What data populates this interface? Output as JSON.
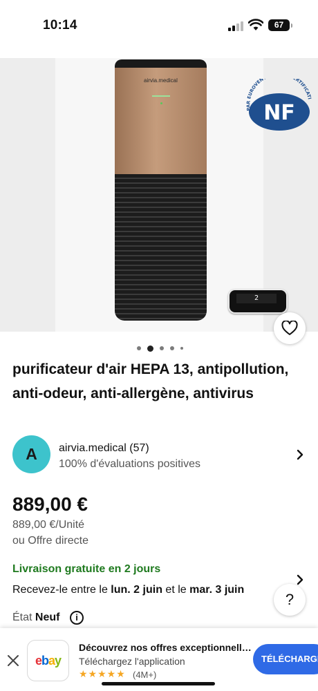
{
  "status_bar": {
    "time": "10:14",
    "battery": "67",
    "icons": [
      "signal-icon",
      "wifi-icon",
      "battery-icon"
    ]
  },
  "product": {
    "image_alt_brand": "airvia.medical",
    "remote_display": "2",
    "carousel_count": 5,
    "carousel_active_index": 1,
    "title": "purificateur d'air HEPA 13, antipollution, anti-odeur, anti-allergène, antivirus"
  },
  "seller": {
    "avatar_letter": "A",
    "name": "airvia.medical (57)",
    "feedback": "100% d'évaluations positives"
  },
  "pricing": {
    "price": "889,00 €",
    "unit_price": "889,00 €/Unité",
    "best_offer": "ou Offre directe"
  },
  "shipping": {
    "free_label": "Livraison gratuite en 2 jours",
    "delivery_prefix": "Recevez-le entre le ",
    "date_start": "lun. 2 juin",
    "delivery_mid": " et le ",
    "date_end": "mar. 3 juin"
  },
  "condition": {
    "label": "État ",
    "value": "Neuf",
    "info_symbol": "i"
  },
  "help": {
    "symbol": "?"
  },
  "app_banner": {
    "close_symbol": "×",
    "logo_letters": [
      "e",
      "b",
      "a",
      "y"
    ],
    "title": "Découvrez nos offres exceptionnelles",
    "subtitle": "Téléchargez l'application",
    "stars": "★★★★★",
    "rating_count": "(4M+)",
    "download_label": "TÉLÉCHARGER"
  },
  "colors": {
    "accent_blue": "#2f6ae6",
    "shipping_green": "#1f7a1f",
    "avatar_teal": "#3dc3cc",
    "star_gold": "#f5a623"
  }
}
